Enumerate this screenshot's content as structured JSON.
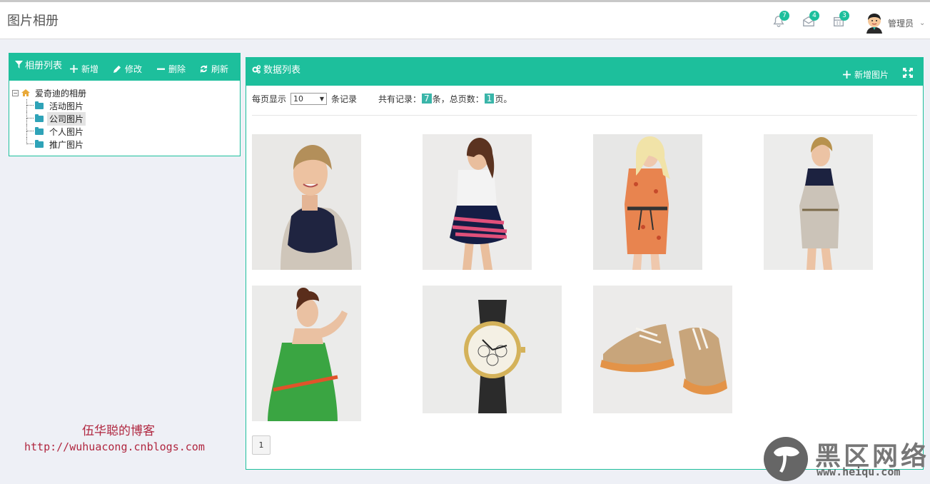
{
  "header": {
    "title": "图片相册",
    "notifications": [
      {
        "icon": "bell-icon",
        "count": "7"
      },
      {
        "icon": "mail-icon",
        "count": "4"
      },
      {
        "icon": "calendar-icon",
        "count": "3"
      }
    ],
    "user_name": "管理员"
  },
  "tree_panel": {
    "title": "相册列表",
    "toolbar": {
      "add": "新增",
      "edit": "修改",
      "delete": "删除",
      "refresh": "刷新"
    },
    "root": "爱奇迪的相册",
    "items": [
      {
        "label": "活动图片",
        "selected": false
      },
      {
        "label": "公司图片",
        "selected": true
      },
      {
        "label": "个人图片",
        "selected": false
      },
      {
        "label": "推广图片",
        "selected": false
      }
    ]
  },
  "main_panel": {
    "title": "数据列表",
    "add_image": "新增图片",
    "pager": {
      "per_page_prefix": "每页显示",
      "per_page_value": "10",
      "per_page_suffix": "条记录",
      "total_prefix": "共有记录：",
      "total_records": "7",
      "total_mid": "条，总页数：",
      "total_pages": "1",
      "total_suffix": "页。"
    },
    "photos": [
      {
        "name": "photo-woman-gray-dress-1"
      },
      {
        "name": "photo-woman-striped-skirt"
      },
      {
        "name": "photo-woman-floral-dress"
      },
      {
        "name": "photo-woman-gray-dress-2"
      },
      {
        "name": "photo-woman-green-dress"
      },
      {
        "name": "photo-wristwatch"
      },
      {
        "name": "photo-sneakers"
      }
    ],
    "current_page": "1"
  },
  "blog": {
    "title": "伍华聪的博客",
    "url": "http://wuhuacong.cnblogs.com"
  },
  "watermark": {
    "big": "黑区网络",
    "small": "www.heiqu.com"
  },
  "colors": {
    "accent": "#1dbf9c",
    "blog_text": "#b0263f"
  }
}
